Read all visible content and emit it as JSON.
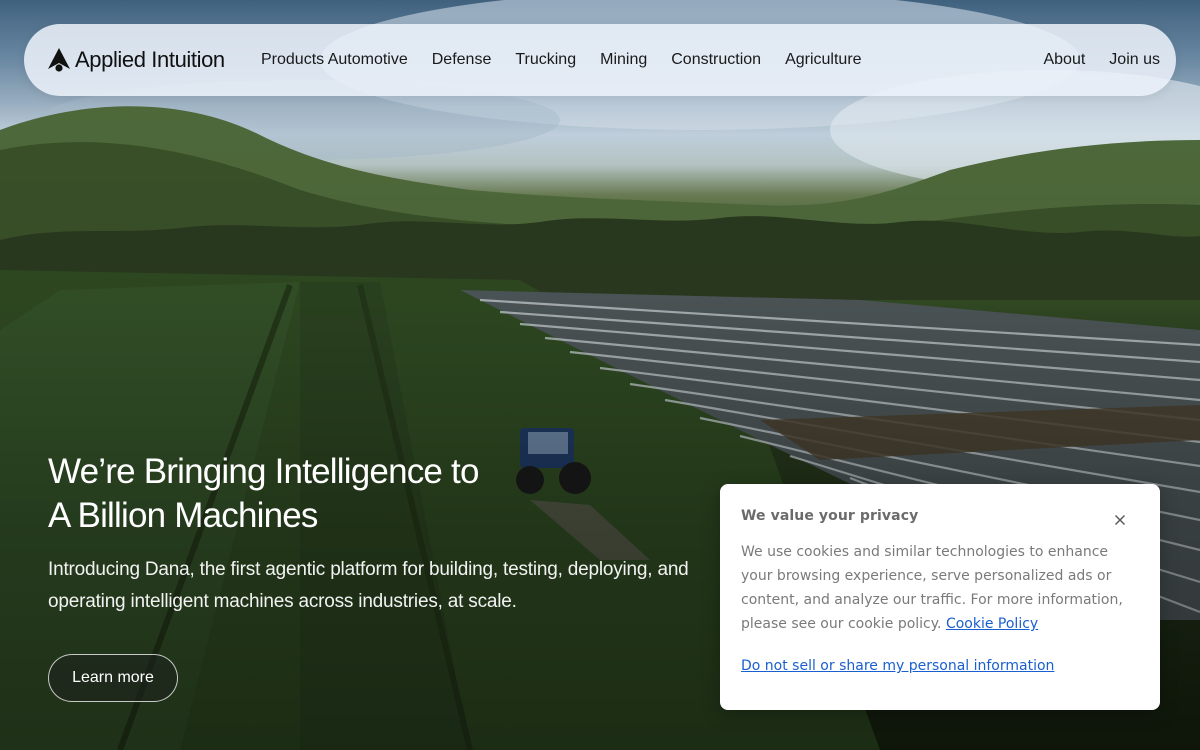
{
  "brand": {
    "name": "Applied Intuition",
    "logo_icon": "applied-intuition-logo-icon"
  },
  "nav": {
    "links": [
      {
        "label": "Products Automotive"
      },
      {
        "label": "Defense"
      },
      {
        "label": "Trucking"
      },
      {
        "label": "Mining"
      },
      {
        "label": "Construction"
      },
      {
        "label": "Agriculture"
      }
    ],
    "right_links": [
      {
        "label": "About"
      },
      {
        "label": "Join us"
      }
    ]
  },
  "hero": {
    "title_line1": "We’re Bringing Intelligence to",
    "title_line2": "A Billion Machines",
    "subtitle": "Introducing Dana, the first agentic platform for building, testing, deploying, and operating intelligent machines across industries, at scale.",
    "cta_label": "Learn more",
    "background_description_icon": "farm-field-tractor-image"
  },
  "cookie_banner": {
    "title": "We value your privacy",
    "body": "We use cookies and similar technologies to enhance your browsing experience, serve personalized ads or content, and analyze our traffic. For more information, please see our cookie policy.",
    "policy_link": "Cookie Policy",
    "do_not_sell_link": "Do not sell or share my personal information",
    "close_icon": "close-icon",
    "link_color": "#1a5fd0"
  },
  "colors": {
    "nav_bg": "#ecf2fa",
    "hero_text": "#ffffff",
    "cookie_text": "#7a7a7a"
  }
}
